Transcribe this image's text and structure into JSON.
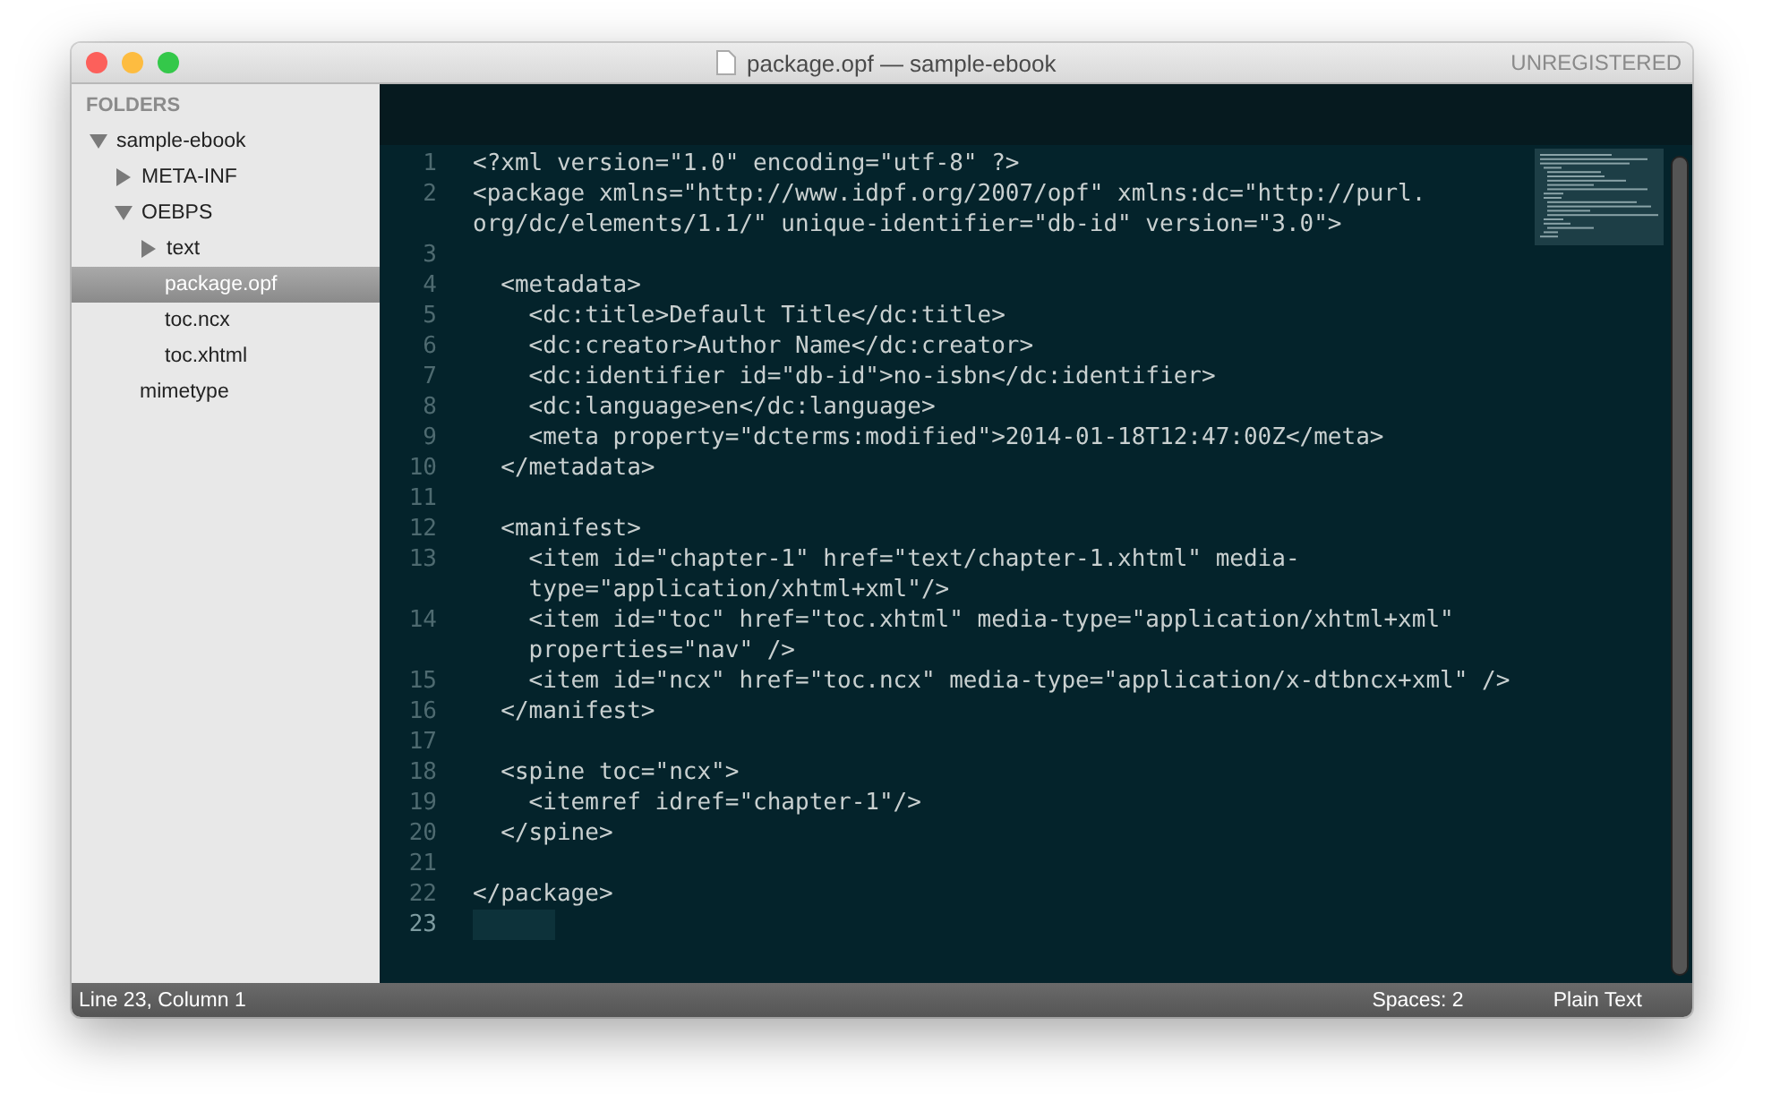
{
  "window": {
    "title": "package.opf — sample-ebook",
    "badge": "UNREGISTERED"
  },
  "sidebar": {
    "heading": "FOLDERS",
    "items": [
      {
        "label": "sample-ebook",
        "kind": "folder",
        "expanded": true,
        "selected": false,
        "children": [
          {
            "label": "META-INF",
            "kind": "folder",
            "expanded": false,
            "selected": false
          },
          {
            "label": "OEBPS",
            "kind": "folder",
            "expanded": true,
            "selected": false,
            "children": [
              {
                "label": "text",
                "kind": "folder",
                "expanded": false,
                "selected": false
              },
              {
                "label": "package.opf",
                "kind": "file",
                "selected": true
              },
              {
                "label": "toc.ncx",
                "kind": "file",
                "selected": false
              },
              {
                "label": "toc.xhtml",
                "kind": "file",
                "selected": false
              }
            ]
          },
          {
            "label": "mimetype",
            "kind": "file",
            "selected": false
          }
        ]
      }
    ]
  },
  "editor": {
    "lines": [
      {
        "number": "1",
        "current": false,
        "segments": [
          "<?xml version=\"1.0\" encoding=\"utf-8\" ?>"
        ]
      },
      {
        "number": "2",
        "current": false,
        "segments": [
          "<package xmlns=\"http://www.idpf.org/2007/opf\" xmlns:dc=\"http://purl.",
          "org/dc/elements/1.1/\" unique-identifier=\"db-id\" version=\"3.0\">"
        ]
      },
      {
        "number": "3",
        "current": false
      },
      {
        "number": "4",
        "current": false,
        "segments": [
          "  <metadata>"
        ]
      },
      {
        "number": "5",
        "current": false,
        "segments": [
          "    <dc:title>Default Title</dc:title>"
        ]
      },
      {
        "number": "6",
        "current": false,
        "segments": [
          "    <dc:creator>Author Name</dc:creator>"
        ]
      },
      {
        "number": "7",
        "current": false,
        "segments": [
          "    <dc:identifier id=\"db-id\">no-isbn</dc:identifier>"
        ]
      },
      {
        "number": "8",
        "current": false,
        "segments": [
          "    <dc:language>en</dc:language>"
        ]
      },
      {
        "number": "9",
        "current": false,
        "segments": [
          "    <meta property=\"dcterms:modified\">2014-01-18T12:47:00Z</meta>"
        ]
      },
      {
        "number": "10",
        "current": false,
        "segments": [
          "  </metadata>"
        ]
      },
      {
        "number": "11",
        "current": false
      },
      {
        "number": "12",
        "current": false,
        "segments": [
          "  <manifest>"
        ]
      },
      {
        "number": "13",
        "current": false,
        "segments": [
          "    <item id=\"chapter-1\" href=\"text/chapter-1.xhtml\" media-",
          "    type=\"application/xhtml+xml\"/>"
        ]
      },
      {
        "number": "14",
        "current": false,
        "segments": [
          "    <item id=\"toc\" href=\"toc.xhtml\" media-type=\"application/xhtml+xml\"",
          "    properties=\"nav\" />"
        ]
      },
      {
        "number": "15",
        "current": false,
        "segments": [
          "    <item id=\"ncx\" href=\"toc.ncx\" media-type=\"application/x-dtbncx+xml\" />"
        ]
      },
      {
        "number": "16",
        "current": false,
        "segments": [
          "  </manifest>"
        ]
      },
      {
        "number": "17",
        "current": false
      },
      {
        "number": "18",
        "current": false,
        "segments": [
          "  <spine toc=\"ncx\">"
        ]
      },
      {
        "number": "19",
        "current": false,
        "segments": [
          "    <itemref idref=\"chapter-1\"/>"
        ]
      },
      {
        "number": "20",
        "current": false,
        "segments": [
          "  </spine>"
        ]
      },
      {
        "number": "21",
        "current": false
      },
      {
        "number": "22",
        "current": false,
        "segments": [
          "</package>"
        ]
      },
      {
        "number": "23",
        "current": true
      }
    ]
  },
  "status_bar": {
    "position": "Line 23, Column 1",
    "indentation": "Spaces: 2",
    "syntax": "Plain Text"
  }
}
